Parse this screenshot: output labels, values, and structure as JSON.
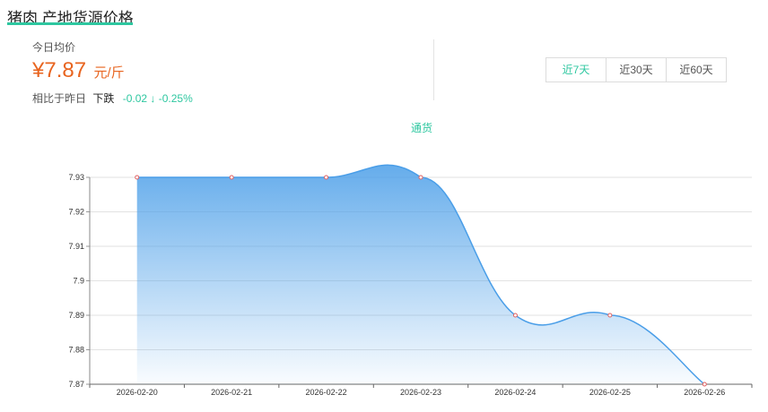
{
  "page": {
    "title": "猪肉 产地货源价格"
  },
  "summary": {
    "today_label": "今日均价",
    "price": "¥7.87",
    "unit": "元/斤",
    "compare_label": "相比于昨日",
    "trend": "下跌",
    "change": "-0.02 ↓ -0.25%"
  },
  "tabs": [
    {
      "label": "近7天",
      "active": true
    },
    {
      "label": "近30天",
      "active": false
    },
    {
      "label": "近60天",
      "active": false
    }
  ],
  "colors": {
    "accent": "#2ec7a0",
    "price": "#e8641f",
    "line": "#4a9ee8",
    "point": "#e06060"
  },
  "chart_data": {
    "type": "area",
    "categories": [
      "2026-02-20",
      "2026-02-21",
      "2026-02-22",
      "2026-02-23",
      "2026-02-24",
      "2026-02-25",
      "2026-02-26"
    ],
    "series": [
      {
        "name": "通货",
        "values": [
          7.93,
          7.93,
          7.93,
          7.93,
          7.89,
          7.89,
          7.87
        ]
      }
    ],
    "yticks": [
      "7.87",
      "7.88",
      "7.89",
      "7.9",
      "7.91",
      "7.92",
      "7.93"
    ],
    "ylim": [
      7.87,
      7.93
    ],
    "smooth": true,
    "grid": true,
    "legend_position": "top-center"
  }
}
